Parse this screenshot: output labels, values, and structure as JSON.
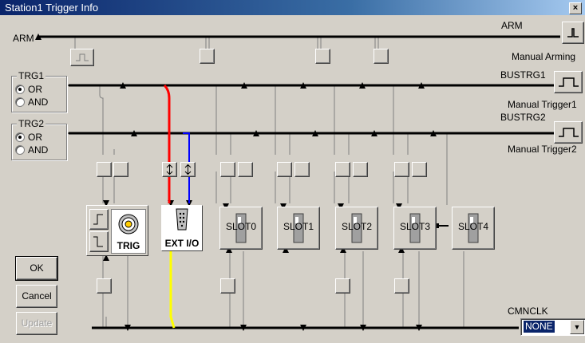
{
  "window": {
    "title": "Station1 Trigger Info",
    "close_label": "×"
  },
  "buses": {
    "arm_left": "ARM",
    "arm_right": "ARM",
    "manual_arming": "Manual Arming",
    "bustrg1": "BUSTRG1",
    "manual_trigger1": "Manual Trigger1",
    "bustrg2": "BUSTRG2",
    "manual_trigger2": "Manual Trigger2",
    "cmnclk": "CMNCLK"
  },
  "trg1": {
    "legend": "TRG1",
    "options": [
      "OR",
      "AND"
    ],
    "selected": "OR"
  },
  "trg2": {
    "legend": "TRG2",
    "options": [
      "OR",
      "AND"
    ],
    "selected": "OR"
  },
  "modules": {
    "trig": "TRIG",
    "ext_io": "EXT I/O",
    "slots": [
      "SLOT0",
      "SLOT1",
      "SLOT2",
      "SLOT3",
      "SLOT4"
    ]
  },
  "buttons": {
    "ok": "OK",
    "cancel": "Cancel",
    "update": "Update"
  },
  "cmnclk_select": {
    "value": "NONE"
  },
  "colors": {
    "ext_red": "#ff0000",
    "ext_blue": "#0000ff",
    "ext_yellow": "#ffff00",
    "bus": "#000000"
  }
}
